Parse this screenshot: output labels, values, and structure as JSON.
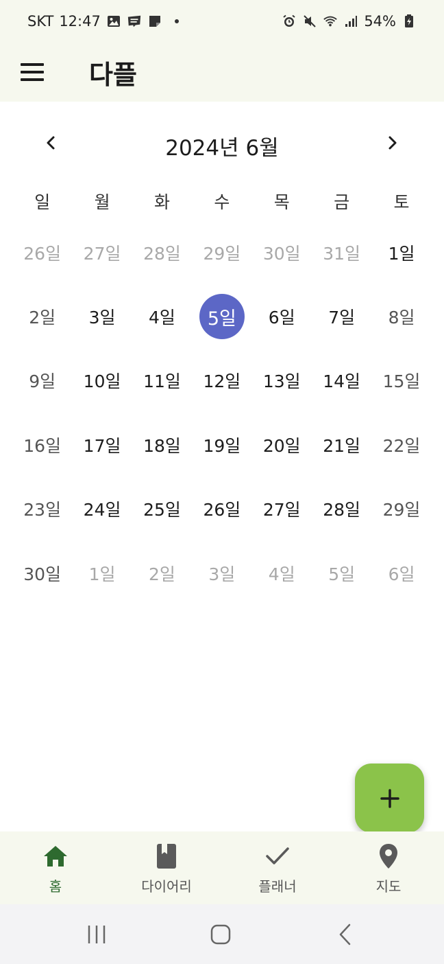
{
  "status_bar": {
    "carrier": "SKT",
    "time": "12:47",
    "battery": "54%"
  },
  "app_bar": {
    "title": "다플"
  },
  "calendar": {
    "month_title": "2024년 6월",
    "weekdays": [
      "일",
      "월",
      "화",
      "수",
      "목",
      "금",
      "토"
    ],
    "selected_day": "5일",
    "selected_color": "#5c67c6",
    "days": [
      {
        "label": "26일",
        "type": "outside"
      },
      {
        "label": "27일",
        "type": "outside"
      },
      {
        "label": "28일",
        "type": "outside"
      },
      {
        "label": "29일",
        "type": "outside"
      },
      {
        "label": "30일",
        "type": "outside"
      },
      {
        "label": "31일",
        "type": "outside"
      },
      {
        "label": "1일",
        "type": "normal"
      },
      {
        "label": "2일",
        "type": "weekend"
      },
      {
        "label": "3일",
        "type": "normal"
      },
      {
        "label": "4일",
        "type": "normal"
      },
      {
        "label": "5일",
        "type": "selected"
      },
      {
        "label": "6일",
        "type": "normal"
      },
      {
        "label": "7일",
        "type": "normal"
      },
      {
        "label": "8일",
        "type": "weekend"
      },
      {
        "label": "9일",
        "type": "weekend"
      },
      {
        "label": "10일",
        "type": "normal"
      },
      {
        "label": "11일",
        "type": "normal"
      },
      {
        "label": "12일",
        "type": "normal"
      },
      {
        "label": "13일",
        "type": "normal"
      },
      {
        "label": "14일",
        "type": "normal"
      },
      {
        "label": "15일",
        "type": "weekend"
      },
      {
        "label": "16일",
        "type": "weekend"
      },
      {
        "label": "17일",
        "type": "normal"
      },
      {
        "label": "18일",
        "type": "normal"
      },
      {
        "label": "19일",
        "type": "normal"
      },
      {
        "label": "20일",
        "type": "normal"
      },
      {
        "label": "21일",
        "type": "normal"
      },
      {
        "label": "22일",
        "type": "weekend"
      },
      {
        "label": "23일",
        "type": "weekend"
      },
      {
        "label": "24일",
        "type": "normal"
      },
      {
        "label": "25일",
        "type": "normal"
      },
      {
        "label": "26일",
        "type": "normal"
      },
      {
        "label": "27일",
        "type": "normal"
      },
      {
        "label": "28일",
        "type": "normal"
      },
      {
        "label": "29일",
        "type": "weekend"
      },
      {
        "label": "30일",
        "type": "weekend"
      },
      {
        "label": "1일",
        "type": "outside"
      },
      {
        "label": "2일",
        "type": "outside"
      },
      {
        "label": "3일",
        "type": "outside"
      },
      {
        "label": "4일",
        "type": "outside"
      },
      {
        "label": "5일",
        "type": "outside"
      },
      {
        "label": "6일",
        "type": "outside"
      }
    ]
  },
  "fab": {
    "icon": "plus-icon",
    "color": "#8bc34a"
  },
  "bottom_nav": {
    "active_color": "#2e6a2f",
    "items": [
      {
        "label": "홈",
        "icon": "home-icon",
        "active": true
      },
      {
        "label": "다이어리",
        "icon": "book-icon",
        "active": false
      },
      {
        "label": "플래너",
        "icon": "check-icon",
        "active": false
      },
      {
        "label": "지도",
        "icon": "location-pin-icon",
        "active": false
      }
    ]
  }
}
